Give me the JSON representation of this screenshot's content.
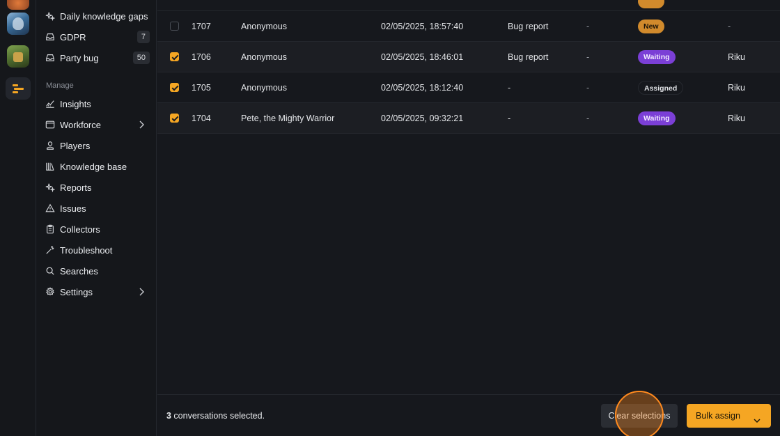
{
  "sidebar": {
    "top_items": [
      {
        "label": "Daily knowledge gaps",
        "icon": "sparkle-icon"
      },
      {
        "label": "GDPR",
        "icon": "inbox-icon",
        "badge": "7"
      },
      {
        "label": "Party bug",
        "icon": "inbox-icon",
        "badge": "50"
      }
    ],
    "section_label": "Manage",
    "manage_items": [
      {
        "label": "Insights",
        "icon": "chart-icon"
      },
      {
        "label": "Workforce",
        "icon": "window-icon",
        "has_submenu": true
      },
      {
        "label": "Players",
        "icon": "person-icon"
      },
      {
        "label": "Knowledge base",
        "icon": "library-icon"
      },
      {
        "label": "Reports",
        "icon": "sparkle-icon"
      },
      {
        "label": "Issues",
        "icon": "warning-icon"
      },
      {
        "label": "Collectors",
        "icon": "clipboard-icon"
      },
      {
        "label": "Troubleshoot",
        "icon": "wand-icon"
      },
      {
        "label": "Searches",
        "icon": "search-icon"
      },
      {
        "label": "Settings",
        "icon": "gear-icon",
        "has_submenu": true
      }
    ]
  },
  "table": {
    "rows": [
      {
        "id": "1707",
        "name": "Anonymous",
        "date": "02/05/2025, 18:57:40",
        "type": "Bug report",
        "extra": "-",
        "status": "New",
        "status_kind": "new",
        "assignee": "-",
        "checked": false
      },
      {
        "id": "1706",
        "name": "Anonymous",
        "date": "02/05/2025, 18:46:01",
        "type": "Bug report",
        "extra": "-",
        "status": "Waiting",
        "status_kind": "waiting",
        "assignee": "Riku",
        "checked": true
      },
      {
        "id": "1705",
        "name": "Anonymous",
        "date": "02/05/2025, 18:12:40",
        "type": "-",
        "extra": "-",
        "status": "Assigned",
        "status_kind": "assigned",
        "assignee": "Riku",
        "checked": true
      },
      {
        "id": "1704",
        "name": "Pete, the Mighty Warrior",
        "date": "02/05/2025, 09:32:21",
        "type": "-",
        "extra": "-",
        "status": "Waiting",
        "status_kind": "waiting",
        "assignee": "Riku",
        "checked": true
      }
    ]
  },
  "footer": {
    "selected_count": "3",
    "selected_suffix": " conversations selected.",
    "clear_label": "Clear selections",
    "bulk_label": "Bulk assign"
  },
  "colors": {
    "accent": "#f5a623",
    "waiting": "#7b3fd6",
    "new": "#d18a2c"
  }
}
